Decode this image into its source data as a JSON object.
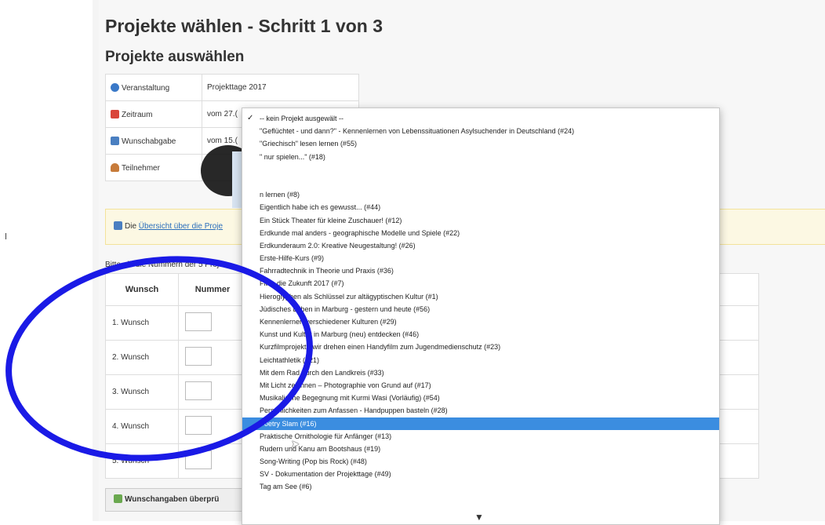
{
  "page": {
    "title": "Projekte wählen - Schritt 1 von 3",
    "subtitle": "Projekte auswählen"
  },
  "info_table": {
    "rows": [
      {
        "label": "Veranstaltung",
        "value": "Projekttage 2017",
        "icon": "info-icon"
      },
      {
        "label": "Zeitraum",
        "value": "vom 27.(",
        "icon": "flag-icon"
      },
      {
        "label": "Wunschabgabe",
        "value": "vom 15.(",
        "icon": "calendar-icon"
      },
      {
        "label": "Teilnehmer",
        "value": "",
        "icon": "user-icon"
      }
    ]
  },
  "notice": {
    "prefix": "Die ",
    "link": "Übersicht über die Proje"
  },
  "wish_prompt": "Bitte gib die Nummern der 5 Proje",
  "wish_table": {
    "headers": [
      "Wunsch",
      "Nummer"
    ],
    "rows": [
      "1. Wunsch",
      "2. Wunsch",
      "3. Wunsch",
      "4. Wunsch",
      "5. Wunsch"
    ]
  },
  "check_button": "Wunschangaben überprü",
  "dropdown": {
    "checked_mark": "✓",
    "selected_index": 26,
    "options": [
      "-- kein Projekt ausgewält --",
      "\"Geflüchtet - und dann?\" - Kennenlernen von Lebenssituationen Asylsuchender in Deutschland (#24)",
      "\"Griechisch\" lesen lernen (#55)",
      "\" nur spielen...\" (#18)",
      "",
      "",
      "n lernen (#8)",
      "Eigentlich habe ich es gewusst... (#44)",
      "Ein Stück Theater für kleine Zuschauer! (#12)",
      "Erdkunde mal anders - geographische Modelle und Spiele (#22)",
      "Erdkunderaum 2.0: Kreative Neugestaltung! (#26)",
      "Erste-Hilfe-Kurs (#9)",
      "Fahrradtechnik in Theorie und Praxis (#36)",
      "Fit in die Zukunft 2017 (#7)",
      "Hieroglyphen als Schlüssel zur altägyptischen Kultur (#1)",
      "Jüdisches Leben in Marburg - gestern und heute (#56)",
      "Kennenlernen verschiedener Kulturen (#29)",
      "Kunst und Kultur in Marburg (neu) entdecken (#46)",
      "Kurzfilmprojekt - wir drehen einen Handyfilm zum Jugendmedienschutz (#23)",
      "Leichtathletik (#21)",
      "Mit dem Rad durch den Landkreis (#33)",
      "Mit Licht zeichnen – Photographie von Grund auf (#17)",
      "Musikalische Begegnung mit Kurmi Wasi (Vorläufig) (#54)",
      "Persönlichkeiten zum Anfassen - Handpuppen basteln (#28)",
      "Poetry Slam (#16)",
      "Praktische Ornithologie für Anfänger (#13)",
      "Rudern und Kanu am Bootshaus (#19)",
      "Song-Writing (Pop bis Rock) (#48)",
      "SV - Dokumentation der Projekttage (#49)",
      "Tag am See (#6)"
    ]
  },
  "colors": {
    "annotation_ring": "#1a1ae6",
    "selection": "#3b8de0",
    "notice_bg": "#fcf8e3"
  }
}
